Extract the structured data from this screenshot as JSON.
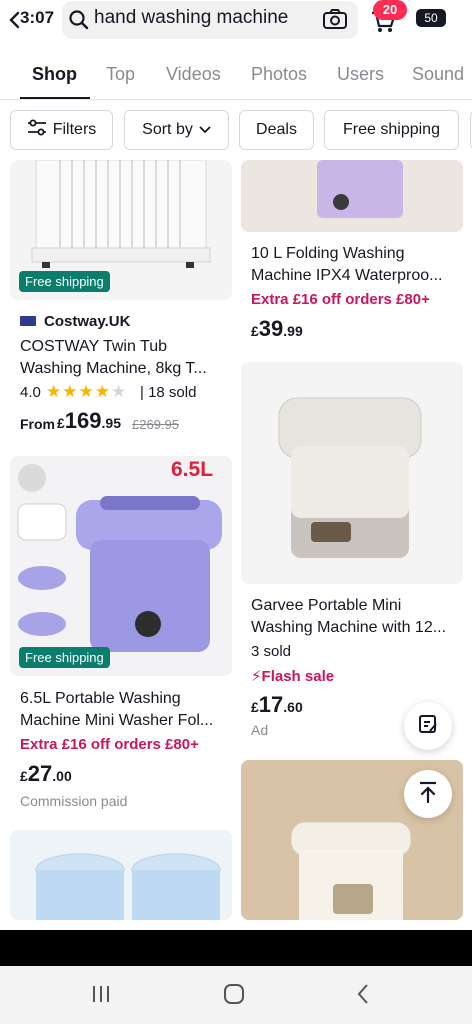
{
  "status": {
    "time": "3:07",
    "battery": "50",
    "cart_count": "20"
  },
  "search": {
    "query": "hand washing machine"
  },
  "tabs": [
    "Shop",
    "Top",
    "Videos",
    "Photos",
    "Users",
    "Sound"
  ],
  "filters": {
    "filters_label": "Filters",
    "sort_label": "Sort by",
    "deals_label": "Deals",
    "free_shipping_label": "Free shipping"
  },
  "products": [
    {
      "badge": "Free shipping",
      "seller": "Costway.UK",
      "title_line1": "COSTWAY Twin Tub",
      "title_line2": "Washing Machine, 8kg T...",
      "rating": "4.0",
      "sold": "18 sold",
      "price_prefix": "From",
      "currency": "£",
      "price_main": "169",
      "price_dec": ".95",
      "old_price": "£269.95"
    },
    {
      "title_line1": "10 L Folding Washing",
      "title_line2": "Machine IPX4 Waterproo...",
      "promo": "Extra £16 off orders £80+",
      "currency": "£",
      "price_main": "39",
      "price_dec": ".99"
    },
    {
      "image_label": "6.5L",
      "badge": "Free shipping",
      "title_line1": "6.5L Portable Washing",
      "title_line2": "Machine Mini Washer Fol...",
      "promo": "Extra £16 off orders £80+",
      "currency": "£",
      "price_main": "27",
      "price_dec": ".00",
      "note": "Commission paid"
    },
    {
      "title_line1": "Garvee Portable Mini",
      "title_line2": "Washing Machine with 12...",
      "sold": "3 sold",
      "flash": "Flash sale",
      "currency": "£",
      "price_main": "17",
      "price_dec": ".60",
      "ad": "Ad"
    }
  ],
  "colors": {
    "accent": "#fe2c55",
    "promo": "#c8175c",
    "free_shipping": "#0b7d6d",
    "star": "#f7b500"
  }
}
